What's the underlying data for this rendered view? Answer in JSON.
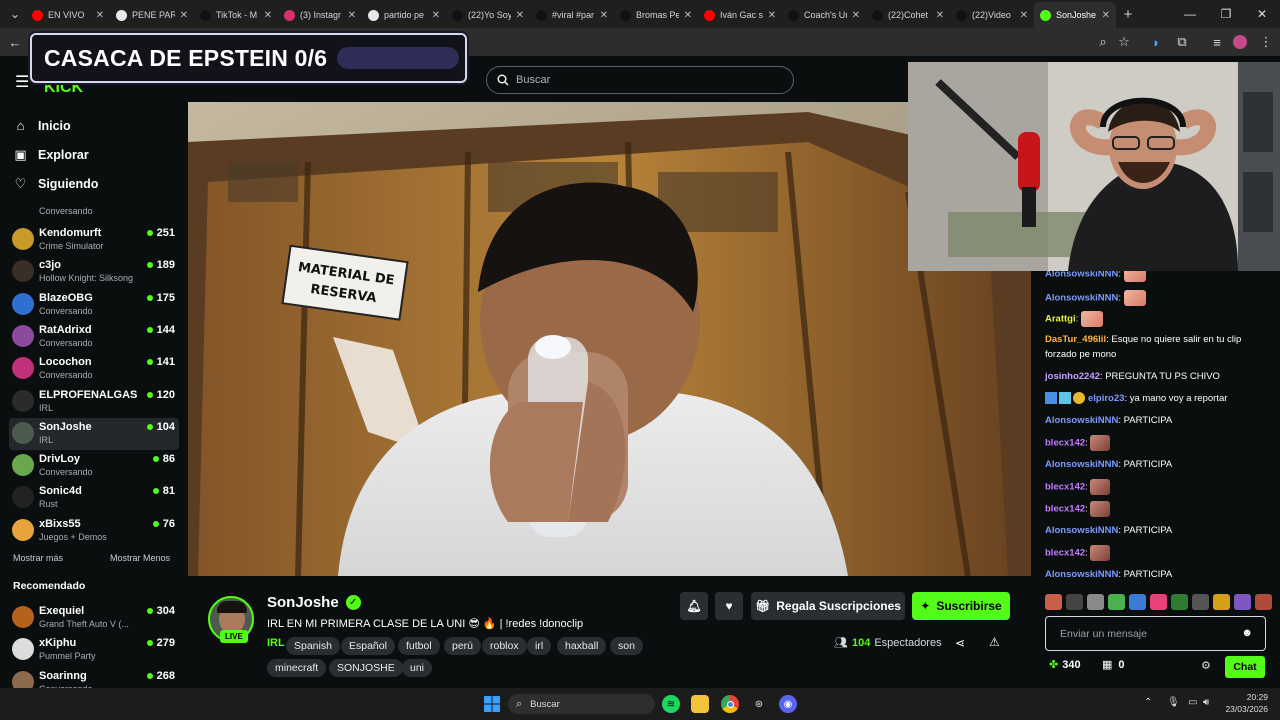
{
  "browser": {
    "tabs": [
      {
        "title": "EN VIVO",
        "favicon": "youtube-icon",
        "color": "#ff0000"
      },
      {
        "title": "PENE PARA",
        "favicon": "google-icon",
        "color": "#e8e8e8"
      },
      {
        "title": "TikTok - M",
        "favicon": "tiktok-icon",
        "color": "#111111"
      },
      {
        "title": "(3) Instagr",
        "favicon": "instagram-icon",
        "color": "#d6306f"
      },
      {
        "title": "partido pe",
        "favicon": "google-icon",
        "color": "#e8e8e8"
      },
      {
        "title": "(22)Yo Soy",
        "favicon": "tiktok-icon",
        "color": "#111111"
      },
      {
        "title": "#viral #par",
        "favicon": "tiktok-icon",
        "color": "#111111"
      },
      {
        "title": "Bromas Pe",
        "favicon": "tiktok-icon",
        "color": "#111111"
      },
      {
        "title": "Iván Gac s",
        "favicon": "youtube-icon",
        "color": "#ff0000"
      },
      {
        "title": "Coach's Ur",
        "favicon": "tiktok-icon",
        "color": "#111111"
      },
      {
        "title": "(22)Cohet",
        "favicon": "tiktok-icon",
        "color": "#111111"
      },
      {
        "title": "(22)Video",
        "favicon": "tiktok-icon",
        "color": "#111111"
      },
      {
        "title": "SonJoshe",
        "favicon": "kick-icon",
        "color": "#53fc18",
        "active": true
      }
    ]
  },
  "overlay": {
    "banner_title": "CASACA DE EPSTEIN 0/6"
  },
  "header": {
    "search_placeholder": "Buscar"
  },
  "sidebar": {
    "nav": [
      {
        "label": "Inicio",
        "icon": "home-icon"
      },
      {
        "label": "Explorar",
        "icon": "compass-icon"
      },
      {
        "label": "Siguiendo",
        "icon": "heart-icon"
      }
    ],
    "partial_row": "Conversando",
    "following": [
      {
        "name": "Kendomurft",
        "category": "Crime Simulator",
        "viewers": "251",
        "color": "#c79a2a"
      },
      {
        "name": "c3jo",
        "category": "Hollow Knight: Silksong",
        "viewers": "189",
        "color": "#3a2e25"
      },
      {
        "name": "BlazeOBG",
        "category": "Conversando",
        "viewers": "175",
        "color": "#2f6fd1"
      },
      {
        "name": "RatAdrixd",
        "category": "Conversando",
        "viewers": "144",
        "color": "#8b4a9a"
      },
      {
        "name": "Locochon",
        "category": "Conversando",
        "viewers": "141",
        "color": "#c2307a"
      },
      {
        "name": "ELPROFENALGAS",
        "category": "IRL",
        "viewers": "120",
        "color": "#2b2b2b"
      },
      {
        "name": "SonJoshe",
        "category": "IRL",
        "viewers": "104",
        "color": "#4d5a4e",
        "active": true
      },
      {
        "name": "DrivLoy",
        "category": "Conversando",
        "viewers": "86",
        "color": "#6aa84f"
      },
      {
        "name": "Sonic4d",
        "category": "Rust",
        "viewers": "81",
        "color": "#222222"
      },
      {
        "name": "xBixs55",
        "category": "Juegos + Demos",
        "viewers": "76",
        "color": "#e8a33a"
      }
    ],
    "show_more": "Mostrar más",
    "show_less": "Mostrar Menos",
    "recommended_heading": "Recomendado",
    "recommended": [
      {
        "name": "Exequiel",
        "category": "Grand Theft Auto V (...",
        "viewers": "304",
        "color": "#b5621c"
      },
      {
        "name": "xKiphu",
        "category": "Pummel Party",
        "viewers": "279",
        "color": "#dcdcdc"
      },
      {
        "name": "Soarinng",
        "category": "Conversando",
        "viewers": "268",
        "color": "#8e6a4c"
      }
    ]
  },
  "video": {
    "sign_text_1": "MATERIAL DE",
    "sign_text_2": "RESERVA"
  },
  "stream": {
    "channel": "SonJoshe",
    "live_badge": "LIVE",
    "title": "IRL EN MI PRIMERA CLASE DE LA UNI 😎 🔥 | !redes !donoclip",
    "category": "IRL",
    "tags": [
      "Spanish",
      "Español",
      "futbol",
      "perú",
      "roblox",
      "irl",
      "haxball",
      "son",
      "minecraft",
      "SONJOSHE",
      "uni"
    ],
    "gift_label": "Regala Suscripciones",
    "subscribe_label": "Suscribirse",
    "viewers": "104",
    "viewers_label": "Espectadores"
  },
  "chat": {
    "messages": [
      {
        "user": "AlonsowskiNNN",
        "color": "#7d9bff",
        "text": "",
        "emote": "hand"
      },
      {
        "user": "AlonsowskiNNN",
        "color": "#7d9bff",
        "text": "",
        "emote": "hand"
      },
      {
        "user": "Arattgi",
        "color": "#e8f24a",
        "text": "",
        "emote": "hand"
      },
      {
        "user": "DasTur_496lil",
        "color": "#ffb347",
        "text": "Esque no quiere salir en tu clip forzado pe mono"
      },
      {
        "user": "josinho2242",
        "color": "#c8a2ff",
        "text": "PREGUNTA TU PS CHIVO"
      },
      {
        "user": "elpiro23",
        "color": "#7d9bff",
        "text": "ya mano voy a reportar",
        "badges": true
      },
      {
        "user": "AlonsowskiNNN",
        "color": "#7d9bff",
        "text": "PARTICIPA"
      },
      {
        "user": "blecx142",
        "color": "#c27bff",
        "text": "",
        "emote": "face"
      },
      {
        "user": "AlonsowskiNNN",
        "color": "#7d9bff",
        "text": "PARTICIPA"
      },
      {
        "user": "blecx142",
        "color": "#c27bff",
        "text": "",
        "emote": "face"
      },
      {
        "user": "blecx142",
        "color": "#c27bff",
        "text": "",
        "emote": "face"
      },
      {
        "user": "AlonsowskiNNN",
        "color": "#7d9bff",
        "text": "PARTICIPA"
      },
      {
        "user": "blecx142",
        "color": "#c27bff",
        "text": "",
        "emote": "face"
      },
      {
        "user": "AlonsowskiNNN",
        "color": "#7d9bff",
        "text": "PARTICIPA"
      }
    ],
    "input_placeholder": "Enviar un mensaje",
    "points": "340",
    "gifts": "0",
    "send_label": "Chat"
  },
  "taskbar": {
    "search_placeholder": "Buscar",
    "time": "20:29",
    "date": "23/03/2026"
  },
  "colors": {
    "accent": "#53fc18",
    "background": "#0b0e0f"
  }
}
